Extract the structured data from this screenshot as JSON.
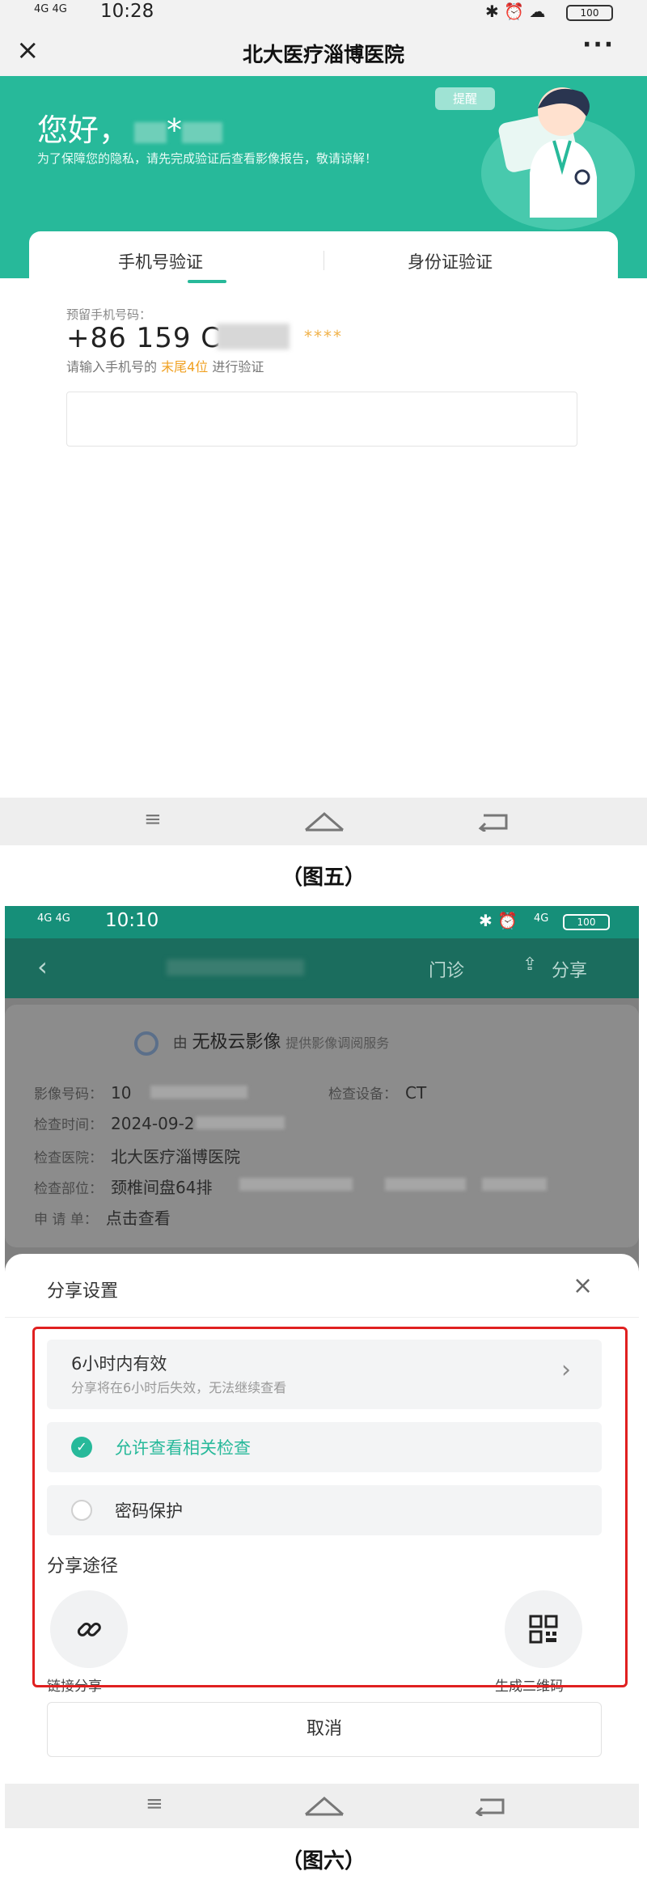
{
  "screen5": {
    "status": {
      "network": "4G 4G",
      "time": "10:28",
      "battery": "100"
    },
    "nav": {
      "close_icon": "close-icon",
      "title": "北大医疗淄博医院",
      "more": "···"
    },
    "banner": {
      "greeting": "您好，",
      "name_masked": "*",
      "notice": "为了保障您的隐私，请先完成验证后查看影像报告，敬请谅解！",
      "badge": "提醒"
    },
    "tabs": [
      {
        "label": "手机号验证",
        "active": true
      },
      {
        "label": "身份证验证",
        "active": false
      }
    ],
    "phone": {
      "label": "预留手机号码：",
      "number": "+86 159 C",
      "stars": "****",
      "hint_prefix": "请输入手机号的",
      "hint_highlight": "末尾4位",
      "hint_suffix": "进行验证"
    },
    "input": {
      "value": "",
      "placeholder": ""
    },
    "caption": "（图五）"
  },
  "screen6": {
    "status": {
      "network": "4G 4G",
      "time": "10:10",
      "signal": "4G",
      "battery": "100"
    },
    "header": {
      "clinic_label": "门诊",
      "share_label": "分享"
    },
    "provider": {
      "prefix": "由",
      "name": "无极云影像",
      "suffix": "提供影像调阅服务"
    },
    "info": {
      "image_no_label": "影像号码：",
      "image_no": "10",
      "device_label": "检查设备：",
      "device": "CT",
      "time_label": "检查时间：",
      "time": "2024-09-2",
      "hospital_label": "检查医院：",
      "hospital": "北大医疗淄博医院",
      "part_label": "检查部位：",
      "part": "颈椎间盘64排",
      "request_label": "申 请 单：",
      "request": "点击查看"
    },
    "sheet": {
      "title": "分享设置",
      "validity_title": "6小时内有效",
      "validity_sub": "分享将在6小时后失效，无法继续查看",
      "allow_related": "允许查看相关检查",
      "allow_related_checked": true,
      "password": "密码保护",
      "password_checked": false,
      "share_route": "分享途径",
      "link_share": "链接分享",
      "qr_share": "生成二维码",
      "cancel": "取消"
    },
    "caption": "（图六）"
  },
  "colors": {
    "accent": "#27b99a",
    "highlight": "#f0a020",
    "frame": "#e02020"
  }
}
